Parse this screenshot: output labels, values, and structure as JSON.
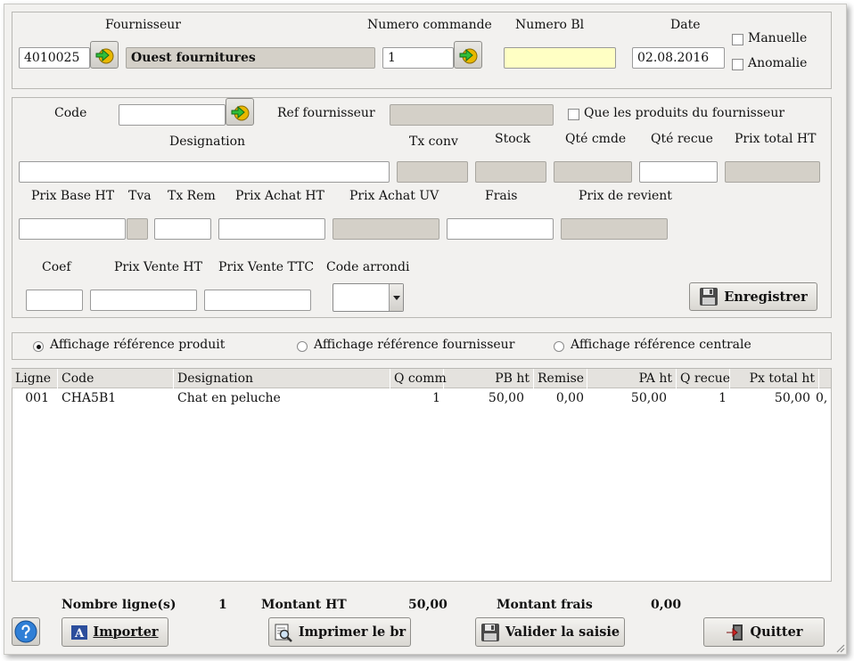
{
  "header": {
    "fournisseur_label": "Fournisseur",
    "fournisseur_code": "4010025",
    "fournisseur_name": "Ouest fournitures",
    "numero_commande_label": "Numero commande",
    "numero_commande": "1",
    "numero_bl_label": "Numero Bl",
    "numero_bl": "",
    "date_label": "Date",
    "date": "02.08.2016",
    "manuelle_label": "Manuelle",
    "anomalie_label": "Anomalie"
  },
  "article": {
    "code_label": "Code",
    "code": "",
    "ref_fournisseur_label": "Ref fournisseur",
    "ref_fournisseur": "",
    "only_supplier_label": "Que les produits du fournisseur",
    "designation_label": "Designation",
    "designation": "",
    "tx_conv_label": "Tx conv",
    "stock_label": "Stock",
    "qte_cmde_label": "Qté cmde",
    "qte_recue_label": "Qté recue",
    "prix_total_ht_label": "Prix total HT",
    "prix_base_ht_label": "Prix Base HT",
    "tva_label": "Tva",
    "tx_rem_label": "Tx Rem",
    "prix_achat_ht_label": "Prix Achat HT",
    "prix_achat_uv_label": "Prix Achat UV",
    "frais_label": "Frais",
    "prix_revient_label": "Prix de revient",
    "coef_label": "Coef",
    "prix_vente_ht_label": "Prix Vente HT",
    "prix_vente_ttc_label": "Prix Vente TTC",
    "code_arrondi_label": "Code arrondi",
    "enregistrer_label": "Enregistrer"
  },
  "display_options": {
    "options": [
      "Affichage référence produit",
      "Affichage référence fournisseur",
      "Affichage référence centrale"
    ],
    "selected": "Affichage référence produit"
  },
  "table": {
    "columns": [
      "Ligne",
      "Code",
      "Designation",
      "Q comm",
      "PB ht",
      "Remise",
      "PA ht",
      "Q recue",
      "Px total ht"
    ],
    "rows": [
      {
        "ligne": "001",
        "code": "CHA5B1",
        "designation": "Chat en peluche",
        "q_comm": "1",
        "pb_ht": "50,00",
        "remise": "0,00",
        "pa_ht": "50,00",
        "q_recue": "1",
        "px_total_ht": "50,00",
        "extra": "0,"
      }
    ]
  },
  "summary": {
    "nombre_lignes_label": "Nombre ligne(s)",
    "nombre_lignes": "1",
    "montant_ht_label": "Montant HT",
    "montant_ht": "50,00",
    "montant_frais_label": "Montant frais",
    "montant_frais": "0,00"
  },
  "footer": {
    "importer_label": "Importer",
    "imprimer_label": "Imprimer le br",
    "valider_label": "Valider la saisie",
    "quitter_label": "Quitter"
  },
  "colors": {
    "readonly_bg": "#d4d0c8",
    "highlight_bg": "#ffffc4",
    "window_bg": "#f2f1ef",
    "help_blue": "#2f7fd6"
  }
}
